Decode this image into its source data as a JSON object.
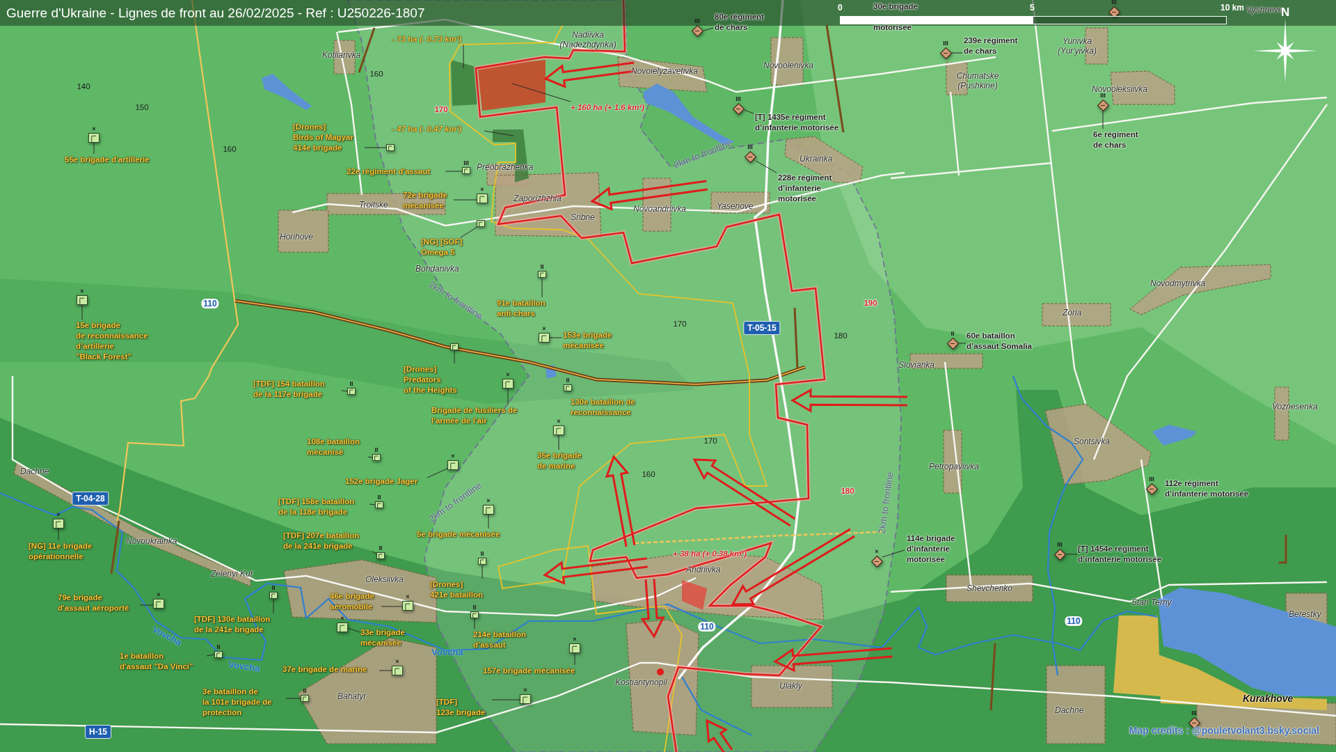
{
  "title_bar": {
    "title": "Guerre d'Ukraine - Lignes de front au 26/02/2025 - Ref : U250226-1807"
  },
  "scale": {
    "labels": [
      "0",
      "5",
      "10 km"
    ]
  },
  "compass": {
    "label": "N"
  },
  "covered_label": {
    "lines": [
      "30e brigade",
      "motorisée"
    ]
  },
  "russian_units": [
    {
      "lines": [
        "80e régiment",
        "de chars"
      ],
      "echelon": "III"
    },
    {
      "echelon": "III"
    },
    {
      "lines": [
        "239e régiment",
        "de chars"
      ],
      "echelon": "III"
    },
    {
      "lines": [
        "[T] 1435e régiment",
        "d’infanterie motorisée"
      ],
      "echelon": "III"
    },
    {
      "lines": [
        "6e régiment",
        "de chars"
      ],
      "echelon": "III"
    },
    {
      "lines": [
        "228e régiment",
        "d’infanterie",
        "motorisée"
      ],
      "echelon": "III"
    },
    {
      "lines": [
        "60e bataillon",
        "d’assaut Somalia"
      ],
      "echelon": "II"
    },
    {
      "lines": [
        "112e régiment",
        "d’infanterie motorisée"
      ],
      "echelon": "III"
    },
    {
      "lines": [
        "114e brigade",
        "d’infanterie",
        "motorisée"
      ],
      "echelon": "×"
    },
    {
      "lines": [
        "[T] 1454e régiment",
        "d’infanterie motorisée"
      ],
      "echelon": "III"
    },
    {
      "echelon": "III"
    }
  ],
  "ukrainian_units": [
    {
      "lines": [
        "55e brigade d'artillerie"
      ],
      "kind": "brigade",
      "echelon": "×"
    },
    {
      "lines": [
        "[Drones]",
        "Birds of Magyar",
        "414e brigade"
      ],
      "kind": "detachment"
    },
    {
      "lines": [
        "22e régiment d'assaut"
      ],
      "kind": "regiment",
      "echelon": "III"
    },
    {
      "lines": [
        "72e brigade",
        "mécanisée"
      ],
      "kind": "brigade",
      "echelon": "×"
    },
    {
      "lines": [
        "[NG] [SOF]",
        "Omega 5"
      ],
      "kind": "detachment"
    },
    {
      "lines": [
        "91e bataillon",
        "anti-chars"
      ],
      "kind": "battalion",
      "echelon": "II"
    },
    {
      "lines": [
        "15e brigade",
        "de reconnaissance",
        "d’artillerie",
        "\"Black Forest\""
      ],
      "kind": "brigade",
      "echelon": "×"
    },
    {
      "lines": [
        "153e brigade",
        "mécanisée"
      ],
      "kind": "brigade",
      "echelon": "×"
    },
    {
      "lines": [
        "[TDF] 154 bataillon",
        "de la 117e brigade"
      ],
      "kind": "battalion",
      "echelon": "II"
    },
    {
      "lines": [
        "[Drones]",
        "Predators",
        "of the Heights"
      ],
      "kind": "detachment"
    },
    {
      "lines": [
        "Brigade de fusiliers de",
        "l'armée de l'air"
      ],
      "kind": "brigade",
      "echelon": "×"
    },
    {
      "lines": [
        "130e bataillon de",
        "reconnaissance"
      ],
      "kind": "battalion",
      "echelon": "II"
    },
    {
      "lines": [
        "108e bataillon",
        "mécanisé"
      ],
      "kind": "battalion",
      "echelon": "II"
    },
    {
      "lines": [
        "35e brigade",
        "de marine"
      ],
      "kind": "brigade",
      "echelon": "×"
    },
    {
      "lines": [
        "152e brigade Jager"
      ],
      "kind": "brigade",
      "echelon": "×"
    },
    {
      "lines": [
        "[TDF] 158e bataillon",
        "de la 118e brigade"
      ],
      "kind": "battalion",
      "echelon": "II"
    },
    {
      "lines": [
        "[NG] 11e brigade",
        "opérationnelle"
      ],
      "kind": "brigade",
      "echelon": "×"
    },
    {
      "lines": [
        "[TDF] 207e bataillon",
        "de la 241e brigade"
      ],
      "kind": "battalion",
      "echelon": "II"
    },
    {
      "lines": [
        "5e brigade mécanisée"
      ],
      "kind": "brigade",
      "echelon": "×"
    },
    {
      "lines": [
        "79e brigade",
        "d'assaut aéroporté"
      ],
      "kind": "brigade",
      "echelon": "×"
    },
    {
      "lines": [
        "46e brigade",
        "aéromobile"
      ],
      "kind": "brigade",
      "echelon": "×"
    },
    {
      "lines": [
        "[Drones]",
        "421e bataillon"
      ],
      "kind": "battalion",
      "echelon": "II"
    },
    {
      "lines": [
        "[TDF] 130e bataillon",
        "de la 241e brigade"
      ],
      "kind": "battalion",
      "echelon": "II"
    },
    {
      "lines": [
        "33e brigade",
        "mécanisée"
      ],
      "kind": "brigade",
      "echelon": "×"
    },
    {
      "lines": [
        "214e bataillon",
        "d’assaut"
      ],
      "kind": "battalion",
      "echelon": "II"
    },
    {
      "lines": [
        "1e bataillon",
        "d'assaut \"Da Vinci\""
      ],
      "kind": "battalion",
      "echelon": "II"
    },
    {
      "lines": [
        "37e brigade de marine"
      ],
      "kind": "brigade",
      "echelon": "×"
    },
    {
      "lines": [
        "157e brigade mécanisée"
      ],
      "kind": "brigade",
      "echelon": "×"
    },
    {
      "lines": [
        "3e bataillon de",
        "la 101e brigade de",
        "protection"
      ],
      "kind": "battalion",
      "echelon": "II"
    },
    {
      "lines": [
        "[TDF]",
        "123e brigade"
      ],
      "kind": "brigade",
      "echelon": "×"
    }
  ],
  "places": [
    {
      "name": "Vyshneve",
      "kind": "village"
    },
    {
      "name": "Nadiivka",
      "alt": "(Nadezhdynka)",
      "kind": "village"
    },
    {
      "name": "Kotliarivka",
      "kind": "village"
    },
    {
      "name": "Yuriivka",
      "alt": "(Yur'yivka)",
      "kind": "village"
    },
    {
      "name": "Novoielyzavetivka",
      "kind": "village"
    },
    {
      "name": "Novoolenivka",
      "kind": "village"
    },
    {
      "name": "Chumatske",
      "alt": "(Pushkine)",
      "kind": "village"
    },
    {
      "name": "Novooleksiivka",
      "kind": "village"
    },
    {
      "name": "Preobrazhenka",
      "kind": "village"
    },
    {
      "name": "Ukrainka",
      "kind": "village"
    },
    {
      "name": "Troitske",
      "kind": "village"
    },
    {
      "name": "Zaporizhzhia",
      "kind": "village"
    },
    {
      "name": "Sribne",
      "kind": "village"
    },
    {
      "name": "Novoandriivka",
      "kind": "village"
    },
    {
      "name": "Yasenove",
      "kind": "village"
    },
    {
      "name": "Horihove",
      "kind": "village"
    },
    {
      "name": "Bohdanivka",
      "kind": "village"
    },
    {
      "name": "Novodmytrivka",
      "kind": "village"
    },
    {
      "name": "Zoria",
      "kind": "village"
    },
    {
      "name": "Slovianka",
      "kind": "village"
    },
    {
      "name": "Voznesenka",
      "kind": "village"
    },
    {
      "name": "Sontsivka",
      "kind": "village"
    },
    {
      "name": "Dachne",
      "kind": "village"
    },
    {
      "name": "Petropavlivka",
      "kind": "village"
    },
    {
      "name": "Novoukrainka",
      "kind": "village"
    },
    {
      "name": "Zelenyi Kut",
      "kind": "village"
    },
    {
      "name": "Oleksiivka",
      "kind": "village"
    },
    {
      "name": "Andriivka",
      "kind": "village"
    },
    {
      "name": "Shevchenko",
      "kind": "village"
    },
    {
      "name": "Stari Terny",
      "kind": "village"
    },
    {
      "name": "Berestky",
      "kind": "village"
    },
    {
      "name": "Kostiantynopil",
      "kind": "village"
    },
    {
      "name": "Ulakly",
      "kind": "village"
    },
    {
      "name": "Bahatyr",
      "kind": "village"
    },
    {
      "name": "Kurakhove",
      "kind": "town"
    },
    {
      "name": "Dachne",
      "kind": "village"
    }
  ],
  "elevations": [
    {
      "text": "160",
      "highlight": false
    },
    {
      "text": "140",
      "highlight": false
    },
    {
      "text": "150",
      "highlight": false
    },
    {
      "text": "170",
      "highlight": true
    },
    {
      "text": "160",
      "highlight": false
    },
    {
      "text": "190",
      "highlight": true
    },
    {
      "text": "170",
      "highlight": false
    },
    {
      "text": "180",
      "highlight": false
    },
    {
      "text": "170",
      "highlight": false
    },
    {
      "text": "160",
      "highlight": false
    },
    {
      "text": "180",
      "highlight": true
    }
  ],
  "road_badges": [
    {
      "text": "110",
      "kind": "local"
    },
    {
      "text": "T-05-15",
      "kind": "territorial"
    },
    {
      "text": "T-04-28",
      "kind": "territorial"
    },
    {
      "text": "110",
      "kind": "local"
    },
    {
      "text": "110",
      "kind": "local"
    },
    {
      "text": "H-15",
      "kind": "territorial"
    }
  ],
  "area_changes": [
    {
      "text": "- 73 ha (- 0.73 km²)",
      "kind": "loss"
    },
    {
      "text": "+ 160 ha (+ 1.6 km²)",
      "kind": "gain"
    },
    {
      "text": "- 47 ha (- 0.47 km²)",
      "kind": "loss"
    },
    {
      "text": "+ 38 ha (+ 0.38 km²)",
      "kind": "gain"
    }
  ],
  "buffer_labels": [
    "2km to frontline",
    "2km to frontline",
    "2km to frontline",
    "2km to frontline"
  ],
  "river_labels": [
    "Vovcha",
    "Vovcha",
    "Vovcha"
  ],
  "credits": "Map credits : @pouletvolant3.bsky.social"
}
